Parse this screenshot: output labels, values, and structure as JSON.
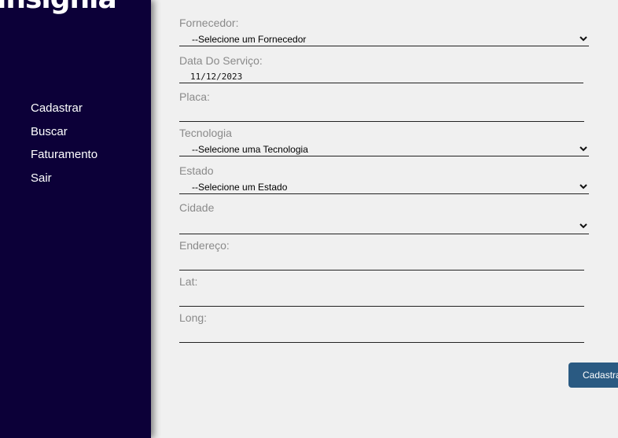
{
  "brand": {
    "logo_text": "insignia"
  },
  "nav": {
    "items": [
      "Cadastrar",
      "Buscar",
      "Faturamento",
      "Sair"
    ]
  },
  "form": {
    "fornecedor": {
      "label": "Fornecedor:",
      "value": "--Selecione um Fornecedor"
    },
    "data_servico": {
      "label": "Data Do Serviço:",
      "value": "11/12/2023"
    },
    "placa": {
      "label": "Placa:",
      "value": ""
    },
    "tecnologia": {
      "label": "Tecnologia",
      "value": "--Selecione uma Tecnologia"
    },
    "estado": {
      "label": "Estado",
      "value": "--Selecione um Estado"
    },
    "cidade": {
      "label": "Cidade",
      "value": ""
    },
    "endereco": {
      "label": "Endereço:",
      "value": ""
    },
    "lat": {
      "label": "Lat:",
      "value": ""
    },
    "long": {
      "label": "Long:",
      "value": ""
    },
    "submit_label": "Cadastrar"
  }
}
